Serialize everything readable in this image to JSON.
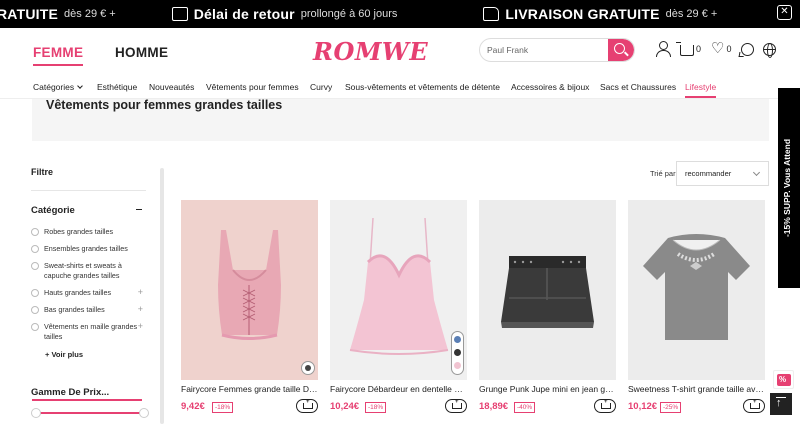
{
  "promo": {
    "items": [
      {
        "strong": "RATUITE",
        "light": "dès 29 € +",
        "icon": "truck-icon"
      },
      {
        "strong": "Délai de retour",
        "light": "prollongé à 60 jours",
        "icon": "return-box-icon"
      },
      {
        "strong": "LIVRAISON GRATUITE",
        "light": "dès 29 € +",
        "icon": "truck-icon"
      }
    ]
  },
  "header": {
    "genders": [
      "FEMME",
      "HOMME"
    ],
    "logo": "ROMWE",
    "search_value": "Paul Frank",
    "cart_count": "0",
    "wishlist_count": "0"
  },
  "nav": {
    "items": [
      "Catégories",
      "Esthétique",
      "Nouveautés",
      "Vêtements pour femmes",
      "Curvy",
      "Sous-vêtements et vêtements de détente",
      "Accessoires & bijoux",
      "Sacs et Chaussures",
      "Lifestyle"
    ],
    "active": "Lifestyle"
  },
  "banner": {
    "title": "Vêtements pour femmes grandes tailles"
  },
  "filters": {
    "title": "Filtre",
    "category_title": "Catégorie",
    "categories": [
      {
        "label": "Robes grandes tailles",
        "expandable": false
      },
      {
        "label": "Ensembles grandes tailles",
        "expandable": false
      },
      {
        "label": "Sweat-shirts et sweats à capuche grandes tailles",
        "expandable": false
      },
      {
        "label": "Hauts grandes tailles",
        "expandable": true
      },
      {
        "label": "Bas grandes tailles",
        "expandable": true
      },
      {
        "label": "Vêtements en maille grandes tailles",
        "expandable": true
      }
    ],
    "more_label": "+ Voir plus",
    "price_title": "Gamme De Prix..."
  },
  "sort": {
    "label": "Trié par",
    "value": "recommander"
  },
  "products": [
    {
      "name": "Fairycore Femmes grande taille Débardeur",
      "price": "9,42€",
      "discount": "-18%",
      "colors": 1
    },
    {
      "name": "Fairycore Débardeur en dentelle grande taille",
      "price": "10,24€",
      "discount": "-18%",
      "colors": 3
    },
    {
      "name": "Grunge Punk Jupe mini en jean grande taille",
      "price": "18,89€",
      "discount": "-40%",
      "colors": 0
    },
    {
      "name": "Sweetness T-shirt grande taille avec nœud",
      "price": "10,12€",
      "discount": "-25%",
      "colors": 0
    }
  ],
  "side_tab": "-15% SUPP. Vous Attend",
  "side_badge": "%",
  "colors": {
    "accent": "#e64072",
    "promo_bg": "#000000",
    "banner_bg": "#f5f5f5"
  }
}
